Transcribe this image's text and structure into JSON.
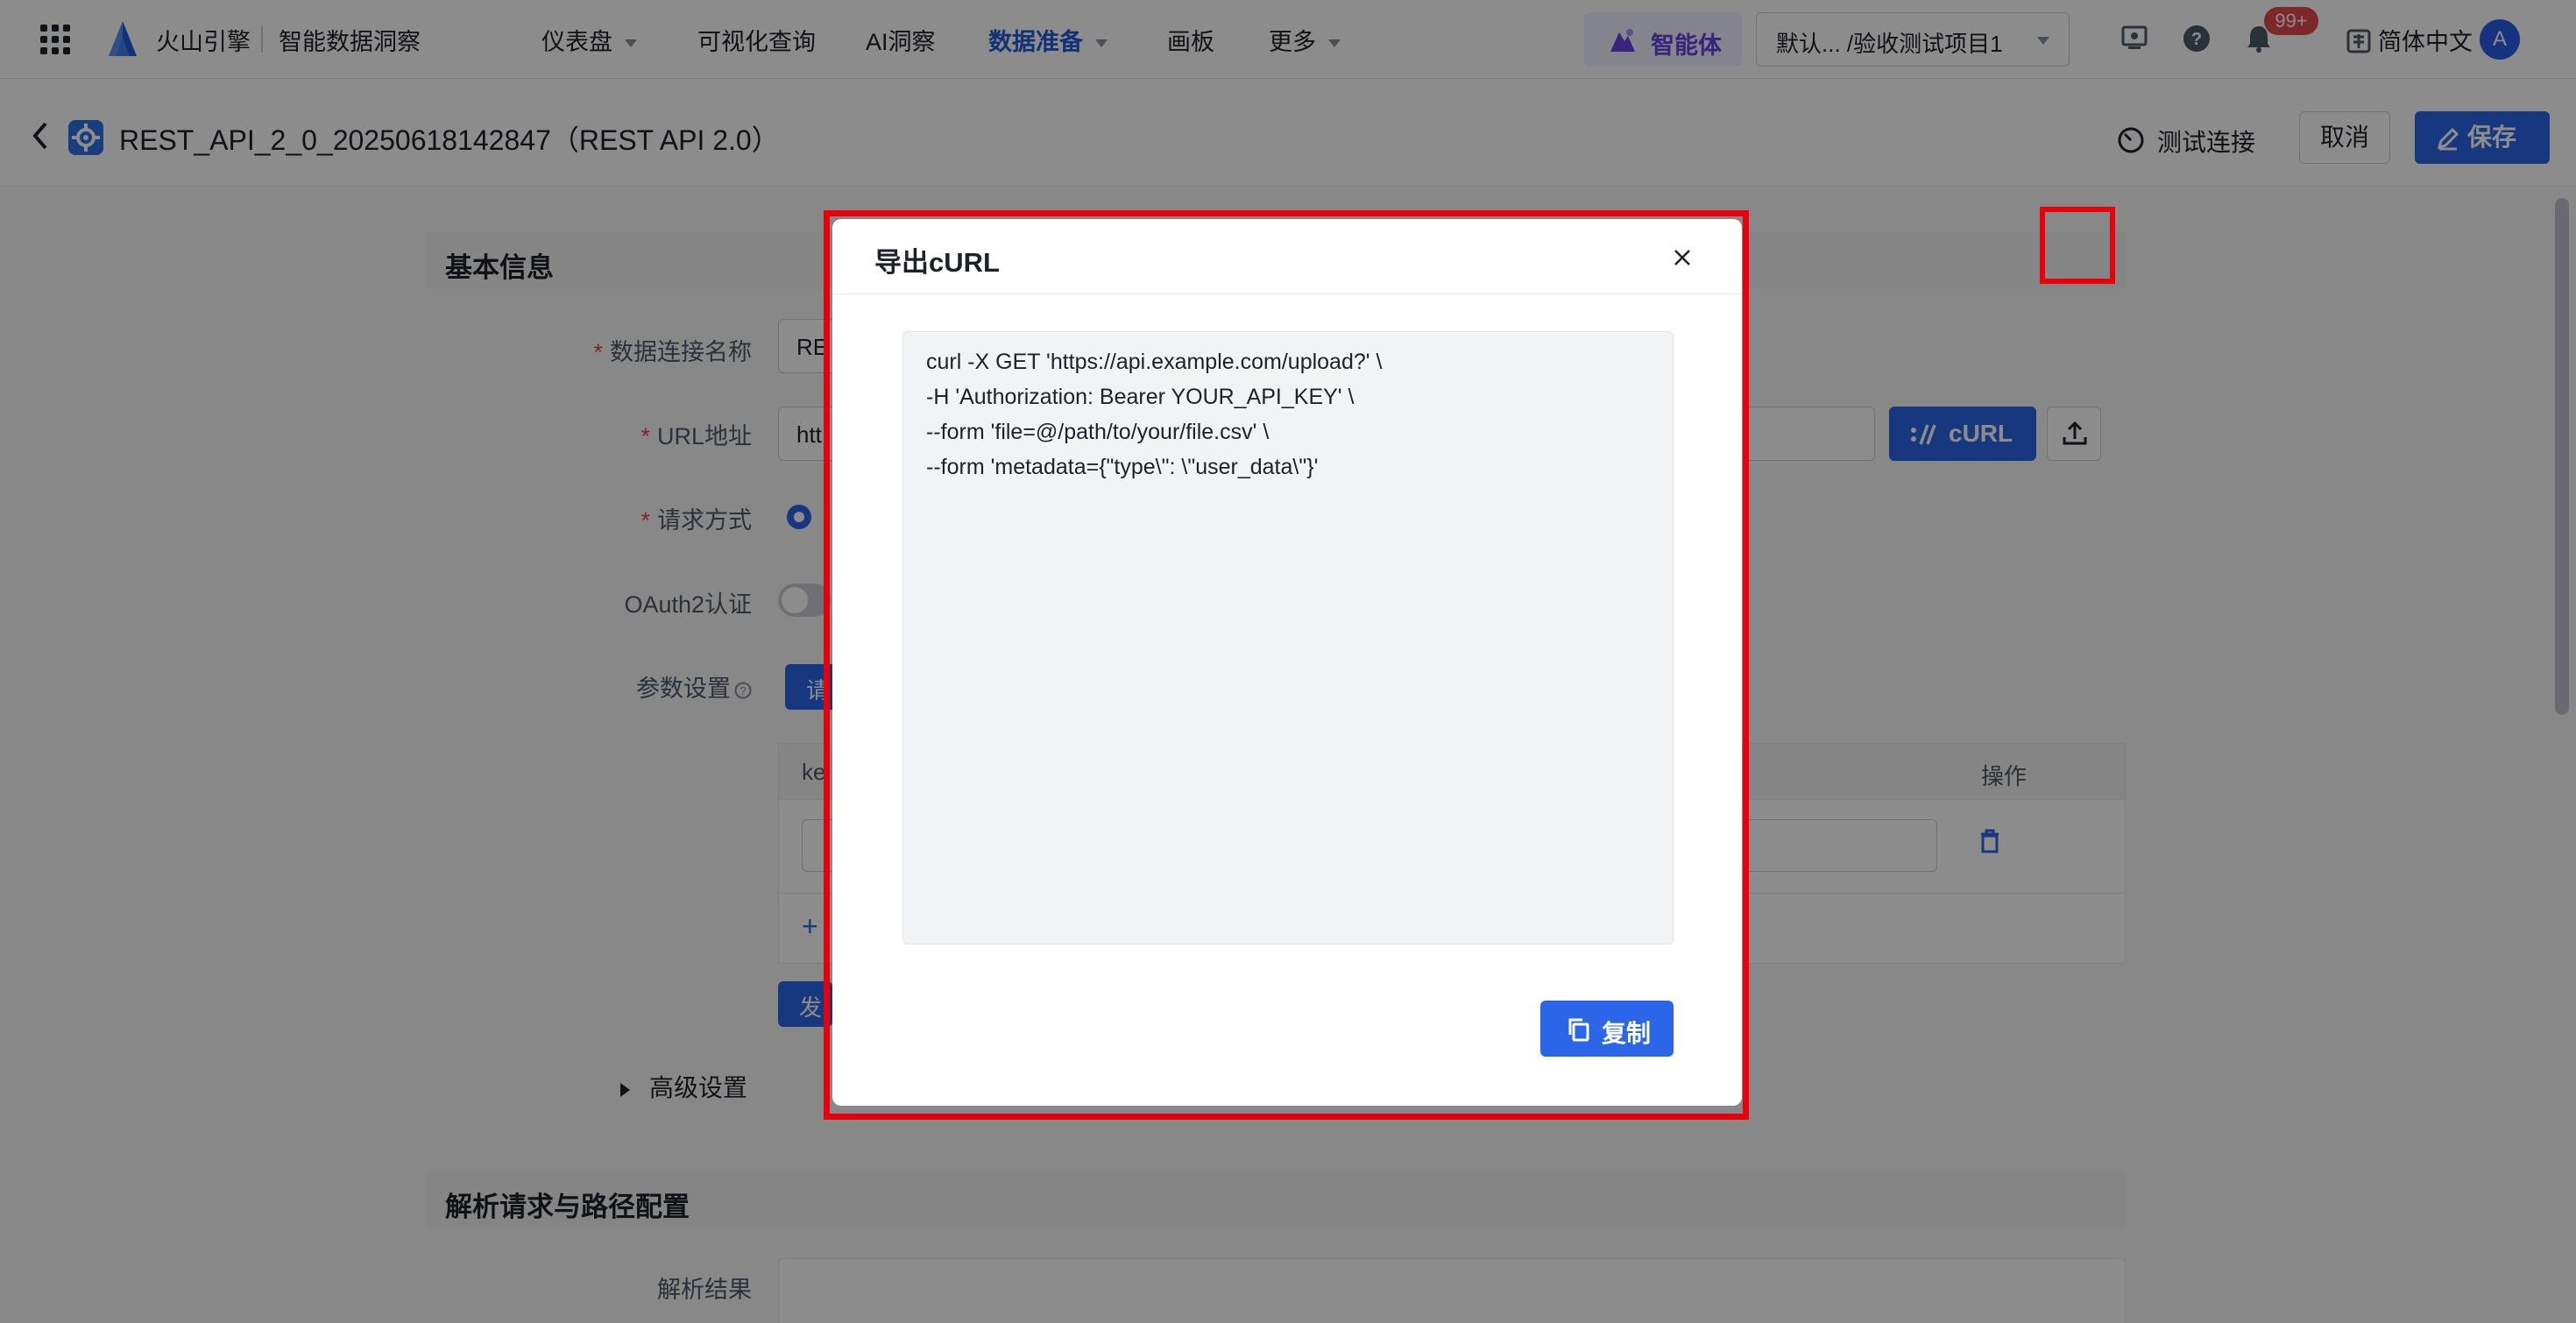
{
  "topnav": {
    "brand": "火山引擎",
    "product": "智能数据洞察",
    "items": [
      {
        "label": "仪表盘",
        "dropdown": true,
        "active": false
      },
      {
        "label": "可视化查询",
        "dropdown": false,
        "active": false
      },
      {
        "label": "AI洞察",
        "dropdown": false,
        "active": false
      },
      {
        "label": "数据准备",
        "dropdown": true,
        "active": true
      },
      {
        "label": "画板",
        "dropdown": false,
        "active": false
      },
      {
        "label": "更多",
        "dropdown": true,
        "active": false
      }
    ],
    "agent_label": "智能体",
    "project_select": "默认... /验收测试项目1",
    "notification_badge": "99+",
    "language": "简体中文",
    "avatar_letter": "A",
    "icons": [
      "apps-grid-icon",
      "brand-logo-icon",
      "screen-icon",
      "help-icon",
      "bell-icon",
      "language-icon"
    ]
  },
  "subheader": {
    "title": "REST_API_2_0_20250618142847（REST API 2.0）",
    "test_connection": "测试连接",
    "cancel": "取消",
    "save": "保存"
  },
  "form": {
    "section_basic": "基本信息",
    "name_label": "数据连接名称",
    "name_value": "RE",
    "url_label": "URL地址",
    "url_value": "htt",
    "curl_button": "cURL",
    "method_label": "请求方式",
    "oauth_label": "OAuth2认证",
    "params_label": "参数设置",
    "params_tab": "请",
    "table_key_header": "ke",
    "table_action_header": "操作",
    "add_symbol": "+",
    "send_button": "发",
    "advanced": "高级设置",
    "section_parse": "解析请求与路径配置",
    "parse_result_label": "解析结果"
  },
  "modal": {
    "title": "导出cURL",
    "code_lines": [
      "curl -X GET 'https://api.example.com/upload?' \\",
      "-H 'Authorization: Bearer YOUR_API_KEY' \\",
      "--form 'file=@/path/to/your/file.csv' \\",
      "--form 'metadata={\"type\\\": \\\"user_data\\\"}'"
    ],
    "copy_button": "复制"
  },
  "colors": {
    "primary": "#2b66e8",
    "active_nav": "#1f5bd6",
    "agent": "#6a3ee8",
    "highlight": "#e8000b",
    "badge": "#e5484d"
  }
}
